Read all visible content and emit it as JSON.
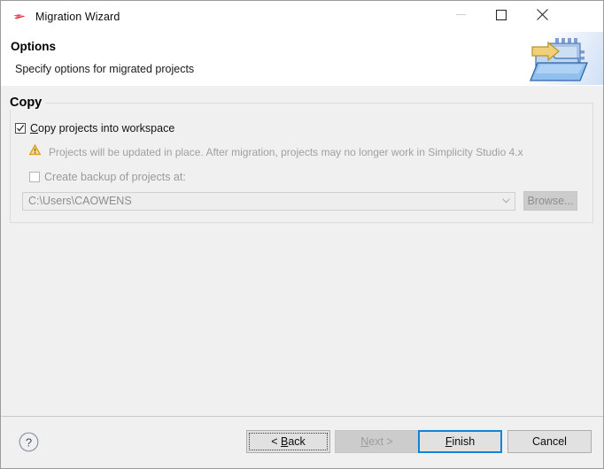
{
  "window": {
    "title": "Migration Wizard",
    "icon": "migration-wizard-icon",
    "controls": {
      "minimize": "minimize-icon",
      "maximize": "maximize-icon",
      "close": "close-icon"
    }
  },
  "header": {
    "title": "Options",
    "subtitle": "Specify options for migrated projects",
    "banner_icon": "import-projects-folder-icon"
  },
  "group": {
    "legend": "Copy",
    "copy_checkbox": {
      "label_mnemonic": "C",
      "label_rest": "opy projects into workspace",
      "checked": true,
      "enabled": true
    },
    "warning": {
      "icon": "warning-triangle-icon",
      "text": "Projects will be updated in place.  After migration, projects may no longer work in Simplicity Studio 4.x"
    },
    "backup_checkbox": {
      "label": "Create backup of projects at:",
      "checked": false,
      "enabled": false
    },
    "path_field": {
      "value": "C:\\Users\\CAOWENS",
      "placeholder": "",
      "enabled": false,
      "dropdown_icon": "chevron-down-icon"
    },
    "browse_button": {
      "label": "Browse...",
      "enabled": false
    }
  },
  "footer": {
    "help_button": {
      "icon": "help-question-icon",
      "label": "?"
    },
    "buttons": [
      {
        "name": "back",
        "label": "< Back",
        "mnemonic": "B",
        "enabled": true,
        "focused": true
      },
      {
        "name": "next",
        "label": "Next >",
        "mnemonic": "N",
        "enabled": false,
        "focused": false
      },
      {
        "name": "finish",
        "label": "Finish",
        "mnemonic": "F",
        "enabled": true,
        "default": true
      },
      {
        "name": "cancel",
        "label": "Cancel",
        "mnemonic": "",
        "enabled": true,
        "focused": false
      }
    ]
  },
  "colors": {
    "accent": "#1383d6",
    "warning": "#d9a21b",
    "dialog_bg": "#f0f0f0",
    "header_bg": "#ffffff",
    "disabled_text": "#9a9a9a"
  }
}
